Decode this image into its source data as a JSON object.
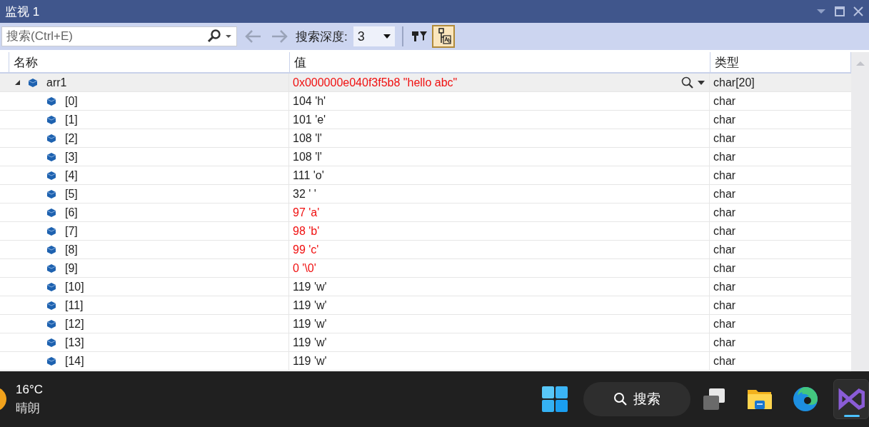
{
  "window": {
    "title": "监视 1"
  },
  "toolbar": {
    "search": {
      "placeholder": "搜索(Ctrl+E)"
    },
    "depth_label": "搜索深度:",
    "depth_value": "3",
    "hex_view": {
      "on": true
    }
  },
  "table": {
    "columns": [
      "名称",
      "值",
      "类型"
    ],
    "rows": [
      {
        "name": "arr1",
        "value": "0x000000e040f3f5b8 \"hello abc\"",
        "type": "char[20]",
        "changed": true,
        "expanded": true,
        "selected": true,
        "children": [
          {
            "name": "[0]",
            "value": "104 'h'",
            "type": "char",
            "changed": false,
            "selected": false
          },
          {
            "name": "[1]",
            "value": "101 'e'",
            "type": "char",
            "changed": false,
            "selected": false
          },
          {
            "name": "[2]",
            "value": "108 'l'",
            "type": "char",
            "changed": false,
            "selected": false
          },
          {
            "name": "[3]",
            "value": "108 'l'",
            "type": "char",
            "changed": false,
            "selected": false
          },
          {
            "name": "[4]",
            "value": "111 'o'",
            "type": "char",
            "changed": false,
            "selected": false
          },
          {
            "name": "[5]",
            "value": "32 ' '",
            "type": "char",
            "changed": false,
            "selected": false
          },
          {
            "name": "[6]",
            "value": "97 'a'",
            "type": "char",
            "changed": true,
            "selected": false
          },
          {
            "name": "[7]",
            "value": "98 'b'",
            "type": "char",
            "changed": true,
            "selected": false
          },
          {
            "name": "[8]",
            "value": "99 'c'",
            "type": "char",
            "changed": true,
            "selected": false
          },
          {
            "name": "[9]",
            "value": "0 '\\0'",
            "type": "char",
            "changed": true,
            "selected": false
          },
          {
            "name": "[10]",
            "value": "119 'w'",
            "type": "char",
            "changed": false,
            "selected": false
          },
          {
            "name": "[11]",
            "value": "119 'w'",
            "type": "char",
            "changed": false,
            "selected": false
          },
          {
            "name": "[12]",
            "value": "119 'w'",
            "type": "char",
            "changed": false,
            "selected": false
          },
          {
            "name": "[13]",
            "value": "119 'w'",
            "type": "char",
            "changed": false,
            "selected": false
          },
          {
            "name": "[14]",
            "value": "119 'w'",
            "type": "char",
            "changed": false,
            "selected": false
          }
        ]
      }
    ]
  },
  "taskbar": {
    "weather": {
      "temperature": "16°C",
      "condition": "晴朗"
    },
    "search": "搜索",
    "apps": [
      {
        "kind": "taskview",
        "active": false
      },
      {
        "kind": "folder",
        "active": false
      },
      {
        "kind": "browser",
        "active": false
      },
      {
        "kind": "studio",
        "active": true
      }
    ]
  }
}
